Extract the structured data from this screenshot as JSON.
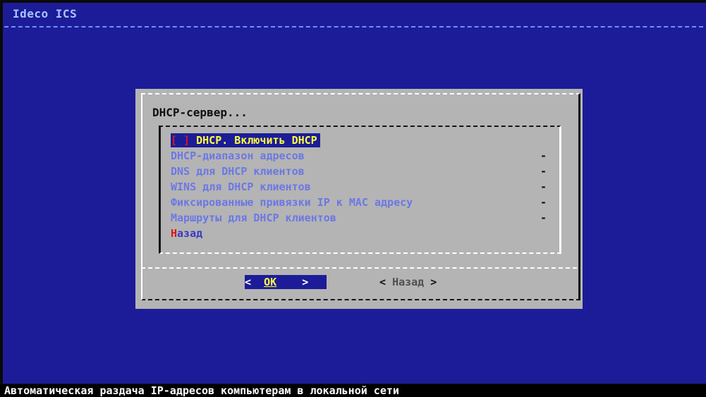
{
  "app": {
    "title": "Ideco ICS"
  },
  "dialog": {
    "title": "DHCP-сервер...",
    "menu": {
      "items": [
        {
          "checkbox": "[ ]",
          "label": "DHCP. Включить DHCP",
          "state": "selected"
        },
        {
          "label": "DHCP-диапазон адресов",
          "dash": "-",
          "state": "disabled"
        },
        {
          "label": "DNS для DHCP клиентов",
          "dash": "-",
          "state": "disabled"
        },
        {
          "label": "WINS для DHCP клиентов",
          "dash": "-",
          "state": "disabled"
        },
        {
          "label": "Фиксированные привязки IP к MAC адресу",
          "dash": "-",
          "state": "disabled"
        },
        {
          "label": "Маршруты для DHCP клиентов",
          "dash": "-",
          "state": "disabled"
        }
      ],
      "back": {
        "hotkey": "Н",
        "rest": "азад"
      }
    },
    "buttons": {
      "ok": {
        "left": "<",
        "label": "OK",
        "right": ">"
      },
      "back": {
        "left": "<",
        "label": "Назад",
        "right": ">"
      }
    }
  },
  "status_bar": {
    "text": "Автоматическая раздача IP-адресов компьютерам в локальной сети"
  },
  "colors": {
    "screen_bg": "#1c1c98",
    "dialog_bg": "#b4b4b4",
    "selected_text": "#ffff40",
    "disabled_text": "#6c78e4",
    "hotkey": "#d81818"
  }
}
